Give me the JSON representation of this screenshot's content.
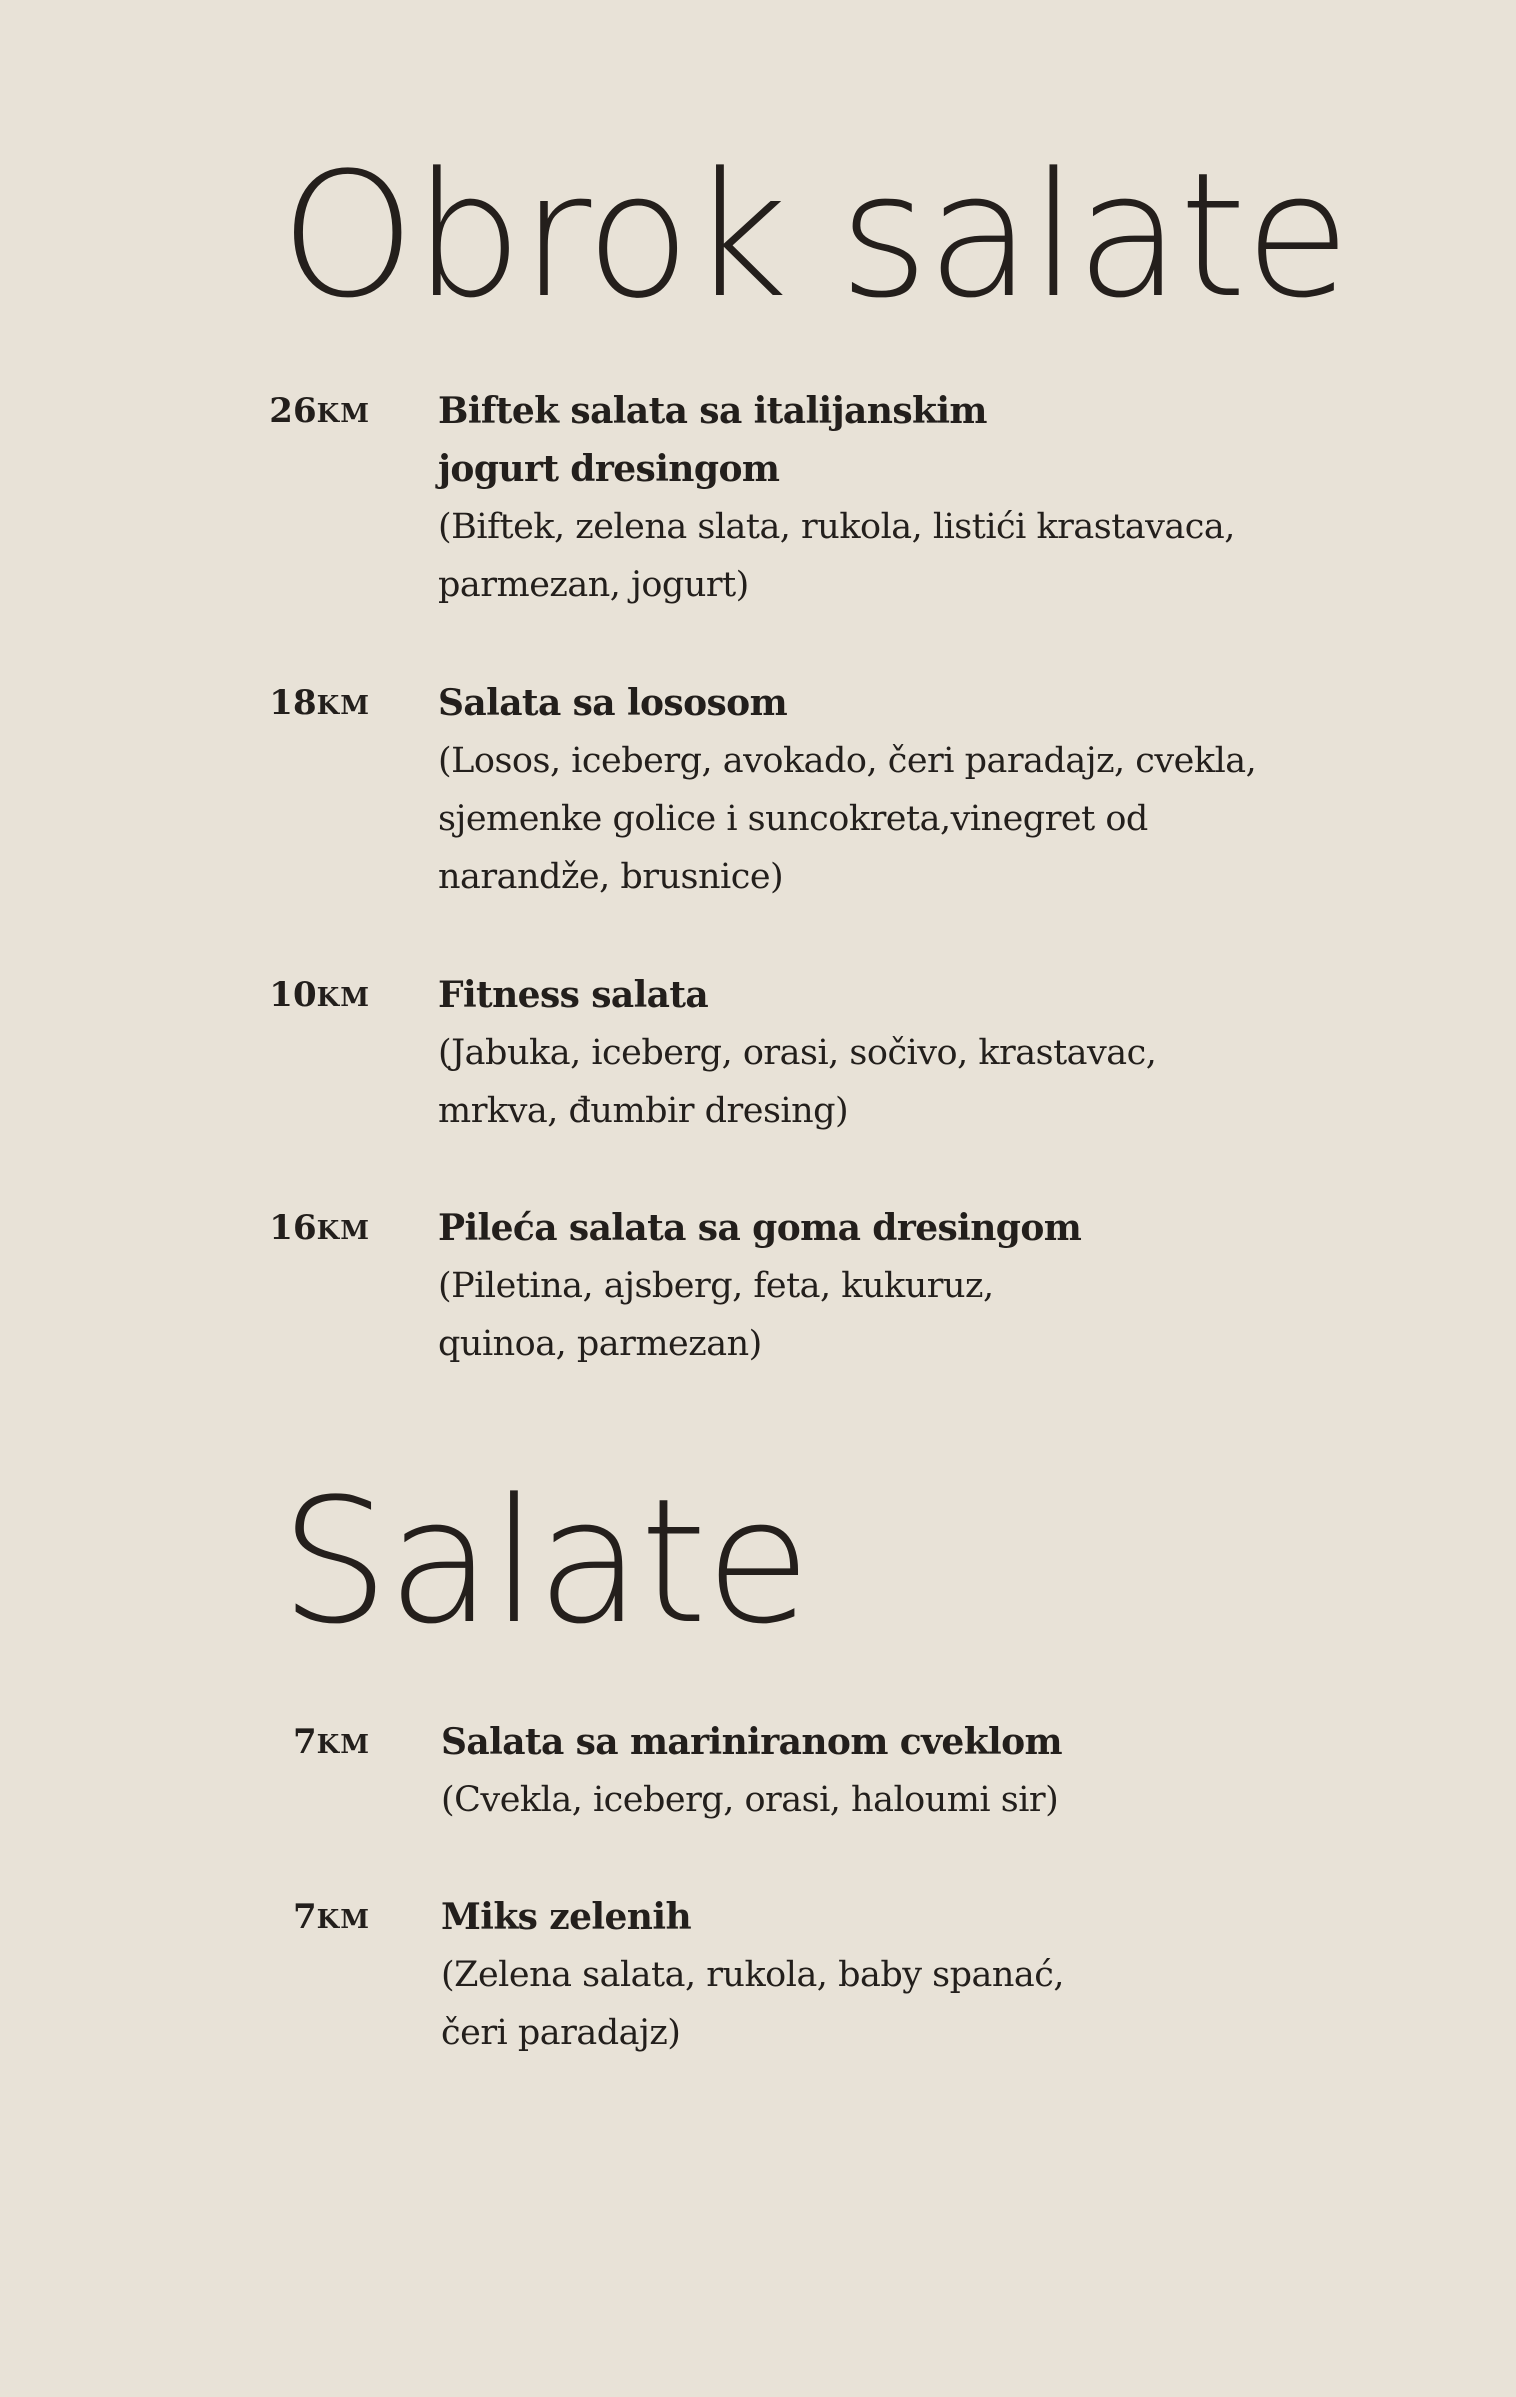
{
  "sections": [
    {
      "title": "Obrok salate",
      "items": [
        {
          "price": "26",
          "currency": "KM",
          "name": "Biftek salata sa italijanskim\njogurt dresingom",
          "description": "(Biftek, zelena slata, rukola, listići krastavaca,\nparmezan, jogurt)"
        },
        {
          "price": "18",
          "currency": "KM",
          "name": "Salata sa lososom",
          "description": "(Losos, iceberg, avokado, čeri paradajz, cvekla,\nsjemenke golice i suncokreta,vinegret od\nnarandže, brusnice)"
        },
        {
          "price": "10",
          "currency": "KM",
          "name": "Fitness salata",
          "description": "(Jabuka, iceberg, orasi, sočivo, krastavac,\nmrkva, đumbir dresing)"
        },
        {
          "price": "16",
          "currency": "KM",
          "name": "Pileća salata sa goma dresingom",
          "description": "(Piletina, ajsberg, feta, kukuruz,\nquinoa, parmezan)"
        }
      ]
    },
    {
      "title": "Salate",
      "items": [
        {
          "price": "7",
          "currency": "KM",
          "name": "Salata sa mariniranom cveklom",
          "description": "(Cvekla, iceberg, orasi, haloumi sir)"
        },
        {
          "price": "7",
          "currency": "KM",
          "name": "Miks zelenih",
          "description": "(Zelena salata, rukola, baby spanać,\nčeri paradajz)"
        }
      ]
    }
  ]
}
